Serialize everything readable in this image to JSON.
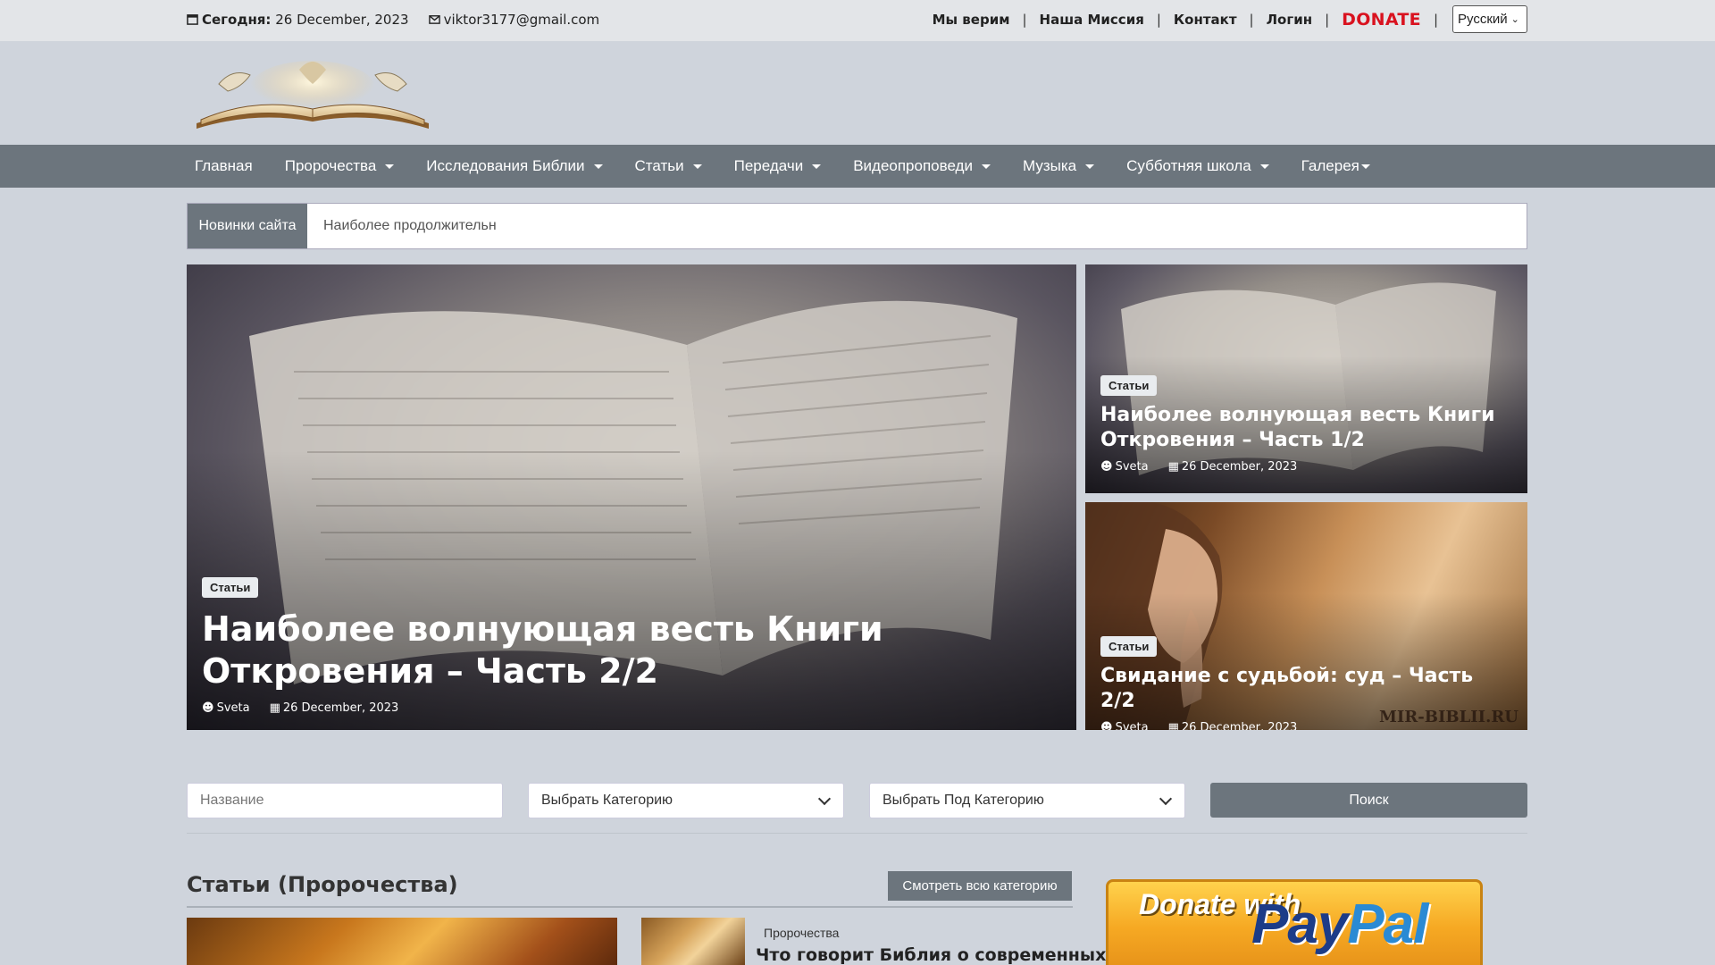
{
  "topbar": {
    "today_label": "Сегодня:",
    "today_date": "26 December, 2023",
    "email": "viktor3177@gmail.com",
    "links": [
      "Мы верим",
      "Наша Миссия",
      "Контакт",
      "Логин"
    ],
    "donate": "DONATE",
    "language": "Русский"
  },
  "nav": {
    "items": [
      "Главная",
      "Пророчества",
      "Исследования Библии",
      "Статьи",
      "Передачи",
      "Видеопроповеди",
      "Музыка",
      "Субботняя школа",
      "Галерея"
    ]
  },
  "ticker": {
    "label": "Новинки сайта",
    "text": "Наиболее продолжительн"
  },
  "hero": {
    "main": {
      "badge": "Статьи",
      "title": "Наиболее волнующая весть Книги Откровения – Часть 2/2",
      "author": "Sveta",
      "date": "26 December, 2023"
    },
    "side1": {
      "badge": "Статьи",
      "title": "Наиболее волнующая весть Книги Откровения – Часть 1/2",
      "author": "Sveta",
      "date": "26 December, 2023"
    },
    "side2": {
      "badge": "Статьи",
      "title": "Свидание с судьбой: суд – Часть 2/2",
      "author": "Sveta",
      "date": "26 December, 2023",
      "watermark": "MIR-BIBLII.RU"
    }
  },
  "filters": {
    "name_placeholder": "Название",
    "category": "Выбрать Категорию",
    "subcategory": "Выбрать Под Категорию",
    "search": "Поиск"
  },
  "section": {
    "title": "Статьи (Пророчества)",
    "view_all": "Смотреть всю категорию",
    "post_category": "Пророчества",
    "post_title": "Что говорит Библия о современных"
  },
  "paypal": {
    "donate_with": "Donate with",
    "brand_a": "Pay",
    "brand_b": "Pal"
  },
  "colors": {
    "nav_bg": "#6c757d",
    "donate_red": "#d9121f",
    "page_bg": "#cfd4dc"
  }
}
